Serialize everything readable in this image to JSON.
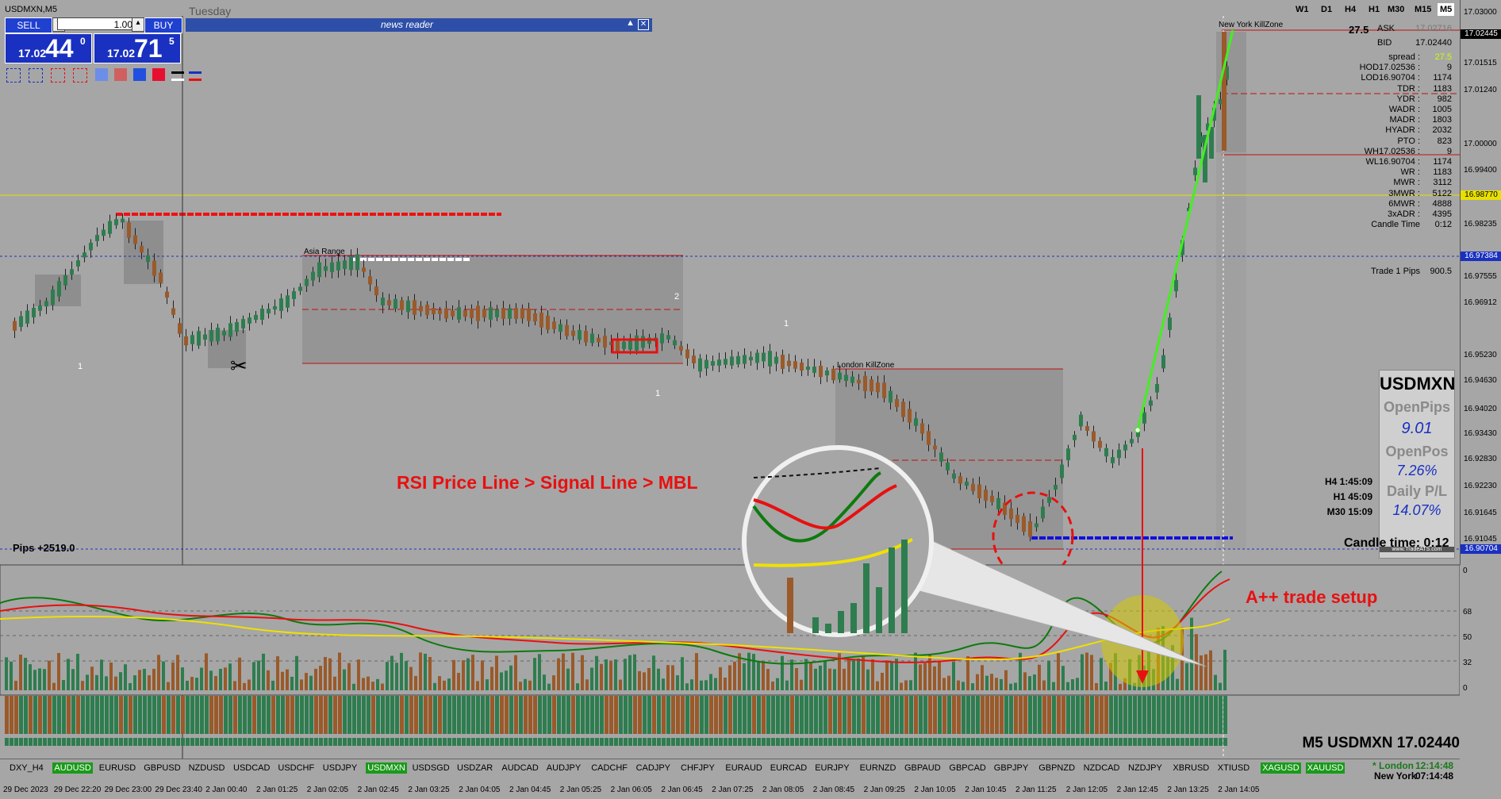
{
  "window": {
    "symbol_title": "USDMXN,M5",
    "day": "Tuesday"
  },
  "timeframes": [
    "W1",
    "D1",
    "H4",
    "H1",
    "M30",
    "M15",
    "M5"
  ],
  "trade_panel": {
    "sell_label": "SELL",
    "buy_label": "BUY",
    "lot": "1.00",
    "bid": {
      "prefix": "17.02",
      "big": "44",
      "sup": "0"
    },
    "ask": {
      "prefix": "17.02",
      "big": "71",
      "sup": "5"
    }
  },
  "news_reader": {
    "title": "news reader"
  },
  "price_axis": {
    "ticks": [
      "17.03000",
      "17.01515",
      "17.01240",
      "17.00000",
      "16.99400",
      "16.98235",
      "16.97555",
      "16.96912",
      "16.95230",
      "16.94630",
      "16.94020",
      "16.93430",
      "16.92830",
      "16.92230",
      "16.91645",
      "16.91045",
      "16.90704"
    ],
    "ask_tag": "17.02445",
    "level_tag_1": "16.98770",
    "level_tag_2": "16.97384",
    "level_tag_3": "16.90704"
  },
  "info_panel": {
    "spread_head": "27.5",
    "ask_label": "ASK",
    "ask_value": "17.02716",
    "bid_label": "BID",
    "bid_value": "17.02440",
    "rows": [
      {
        "k": "spread :",
        "v": "27.5"
      },
      {
        "k": "HOD17.02536 :",
        "v": "9"
      },
      {
        "k": "LOD16.90704 :",
        "v": "1174"
      },
      {
        "k": "TDR :",
        "v": "1183"
      },
      {
        "k": "YDR :",
        "v": "982"
      },
      {
        "k": "WADR :",
        "v": "1005"
      },
      {
        "k": "MADR :",
        "v": "1803"
      },
      {
        "k": "HYADR :",
        "v": "2032"
      },
      {
        "k": "PTO :",
        "v": "823"
      },
      {
        "k": "WH17.02536 :",
        "v": "9"
      },
      {
        "k": "WL16.90704 :",
        "v": "1174"
      },
      {
        "k": "WR :",
        "v": "1183"
      },
      {
        "k": "MWR :",
        "v": "3112"
      },
      {
        "k": "3MWR :",
        "v": "5122"
      },
      {
        "k": "6MWR :",
        "v": "4888"
      },
      {
        "k": "3xADR :",
        "v": "4395"
      },
      {
        "k": "Candle Time",
        "v": "0:12"
      }
    ],
    "trade_pips_label": "Trade 1 Pips",
    "trade_pips_value": "900.5"
  },
  "ats_panel": {
    "symbol": "USDMXN",
    "open_pips_label": "OpenPips",
    "open_pips": "9.01",
    "open_pos_label": "OpenPos",
    "open_pos": "7.26%",
    "daily_pl_label": "Daily P/L",
    "daily_pl": "14.07%",
    "brand": "www.TradeATS.com"
  },
  "timers": {
    "h4": "H4 1:45:09",
    "h1": "H1 45:09",
    "m30": "M30 15:09"
  },
  "candle_time": "Candle time:  0:12",
  "pips_total": "Pips +2519.0",
  "annotations": {
    "rsi_text": "RSI Price Line > Signal Line > MBL",
    "setup_text": "A++ trade setup",
    "asia_range": "Asia Range",
    "london_kz": "London KillZone",
    "newyork_kz": "New York KillZone",
    "marker_1a": "1",
    "marker_1b": "1",
    "marker_1c": "1",
    "marker_2": "2"
  },
  "osc_axis": [
    "0",
    "68",
    "50",
    "32",
    "0"
  ],
  "footer_title": "M5 USDMXN 17.02440",
  "symbols": [
    "DXY_H4",
    "AUDUSD",
    "EURUSD",
    "GBPUSD",
    "NZDUSD",
    "USDCAD",
    "USDCHF",
    "USDJPY",
    "USDMXN",
    "USDSGD",
    "USDZAR",
    "AUDCAD",
    "AUDJPY",
    "CADCHF",
    "CADJPY",
    "CHFJPY",
    "EURAUD",
    "EURCAD",
    "EURJPY",
    "EURNZD",
    "GBPAUD",
    "GBPCAD",
    "GBPJPY",
    "GBPNZD",
    "NZDCAD",
    "NZDJPY",
    "XBRUSD",
    "XTIUSD",
    "XAGUSD",
    "XAUUSD"
  ],
  "active_symbols": [
    "AUDUSD",
    "USDMXN",
    "XAGUSD",
    "XAUUSD"
  ],
  "clock": {
    "london_label": "* London",
    "london_time": "12:14:48",
    "ny_label": "New York",
    "ny_time": "07:14:48"
  },
  "time_axis": [
    "29 Dec 2023",
    "29 Dec 22:20",
    "29 Dec 23:00",
    "29 Dec 23:40",
    "2 Jan 00:40",
    "2 Jan 01:25",
    "2 Jan 02:05",
    "2 Jan 02:45",
    "2 Jan 03:25",
    "2 Jan 04:05",
    "2 Jan 04:45",
    "2 Jan 05:25",
    "2 Jan 06:05",
    "2 Jan 06:45",
    "2 Jan 07:25",
    "2 Jan 08:05",
    "2 Jan 08:45",
    "2 Jan 09:25",
    "2 Jan 10:05",
    "2 Jan 10:45",
    "2 Jan 11:25",
    "2 Jan 12:05",
    "2 Jan 12:45",
    "2 Jan 13:25",
    "2 Jan 14:05"
  ],
  "colors": {
    "bull": "#2e7d4f",
    "bear": "#9a5a2a",
    "accent_red": "#e81010",
    "green_line": "#44ee22",
    "blue": "#1a30c0"
  }
}
